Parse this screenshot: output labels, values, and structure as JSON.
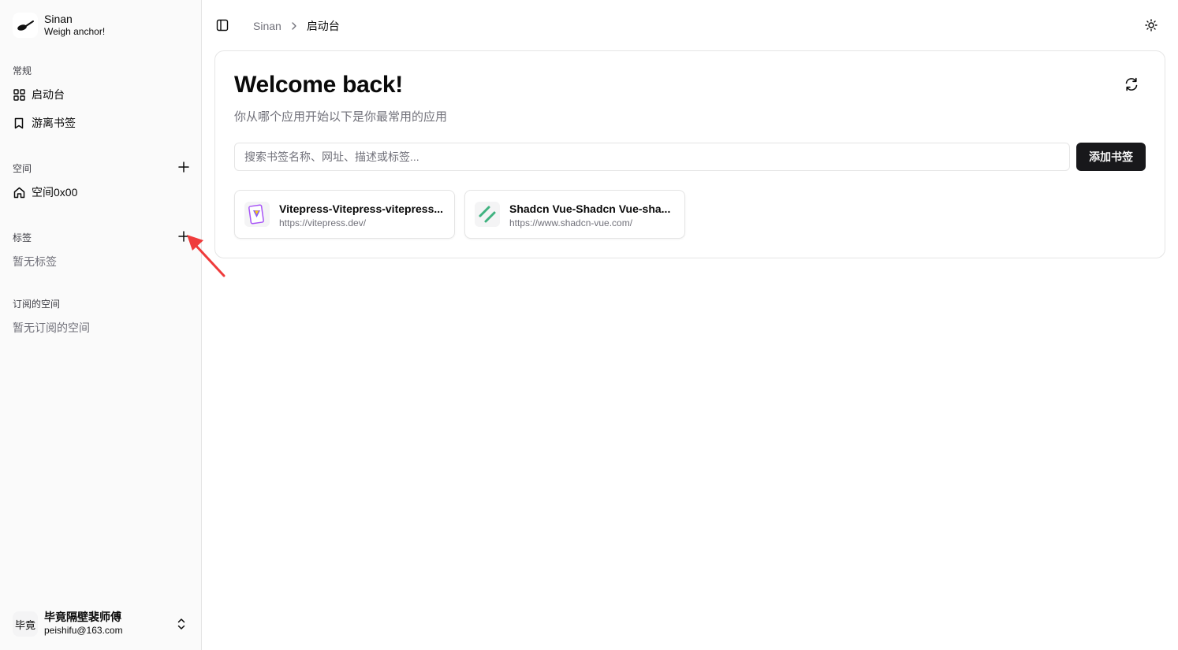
{
  "brand": {
    "name": "Sinan",
    "tagline": "Weigh anchor!"
  },
  "sidebar": {
    "general": {
      "label": "常规",
      "items": [
        {
          "label": "启动台",
          "icon": "grid-icon"
        },
        {
          "label": "游离书签",
          "icon": "bookmark-icon"
        }
      ]
    },
    "spaces": {
      "label": "空间",
      "items": [
        {
          "label": "空间0x00",
          "icon": "home-icon"
        }
      ]
    },
    "tags": {
      "label": "标签",
      "empty": "暂无标签"
    },
    "subscribed": {
      "label": "订阅的空间",
      "empty": "暂无订阅的空间"
    }
  },
  "user": {
    "avatar_text": "毕竟",
    "name": "毕竟隔壁裴师傅",
    "email": "peishifu@163.com"
  },
  "header": {
    "breadcrumb": [
      "Sinan",
      "启动台"
    ]
  },
  "main": {
    "title": "Welcome back!",
    "subtitle": "你从哪个应用开始以下是你最常用的应用",
    "search_placeholder": "搜索书签名称、网址、描述或标签...",
    "add_button": "添加书签",
    "bookmarks": [
      {
        "title": "Vitepress-Vitepress-vitepress...",
        "url": "https://vitepress.dev/",
        "icon": "vitepress-logo-icon"
      },
      {
        "title": "Shadcn Vue-Shadcn Vue-sha...",
        "url": "https://www.shadcn-vue.com/",
        "icon": "shadcn-logo-icon"
      }
    ]
  },
  "colors": {
    "accent": "#18181b",
    "annotation_arrow": "#ef3b3b",
    "muted_text": "#71717a",
    "border": "#e5e5e5"
  }
}
